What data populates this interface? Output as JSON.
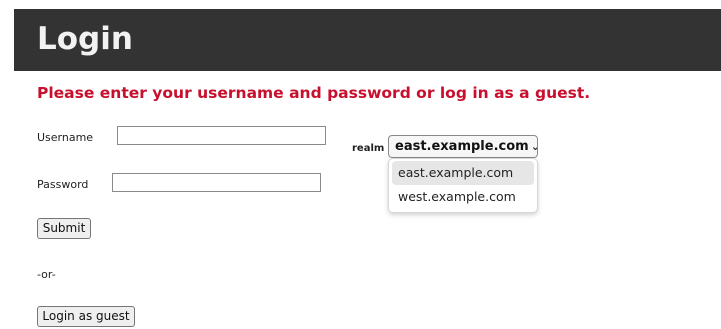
{
  "header": {
    "title": "Login"
  },
  "message": "Please enter your username and password or log in as a guest.",
  "form": {
    "username_label": "Username",
    "username_value": "",
    "password_label": "Password",
    "password_value": "",
    "submit_label": "Submit",
    "or_text": "-or-",
    "guest_label": "Login as guest"
  },
  "realm": {
    "label": "realm",
    "selected": "east.example.com",
    "options": [
      "east.example.com",
      "west.example.com"
    ]
  },
  "colors": {
    "header_bg": "#333333",
    "header_text": "#f2f2f2",
    "message": "#c8102e"
  },
  "icons": {
    "select_arrow": "chevron-down-icon"
  }
}
